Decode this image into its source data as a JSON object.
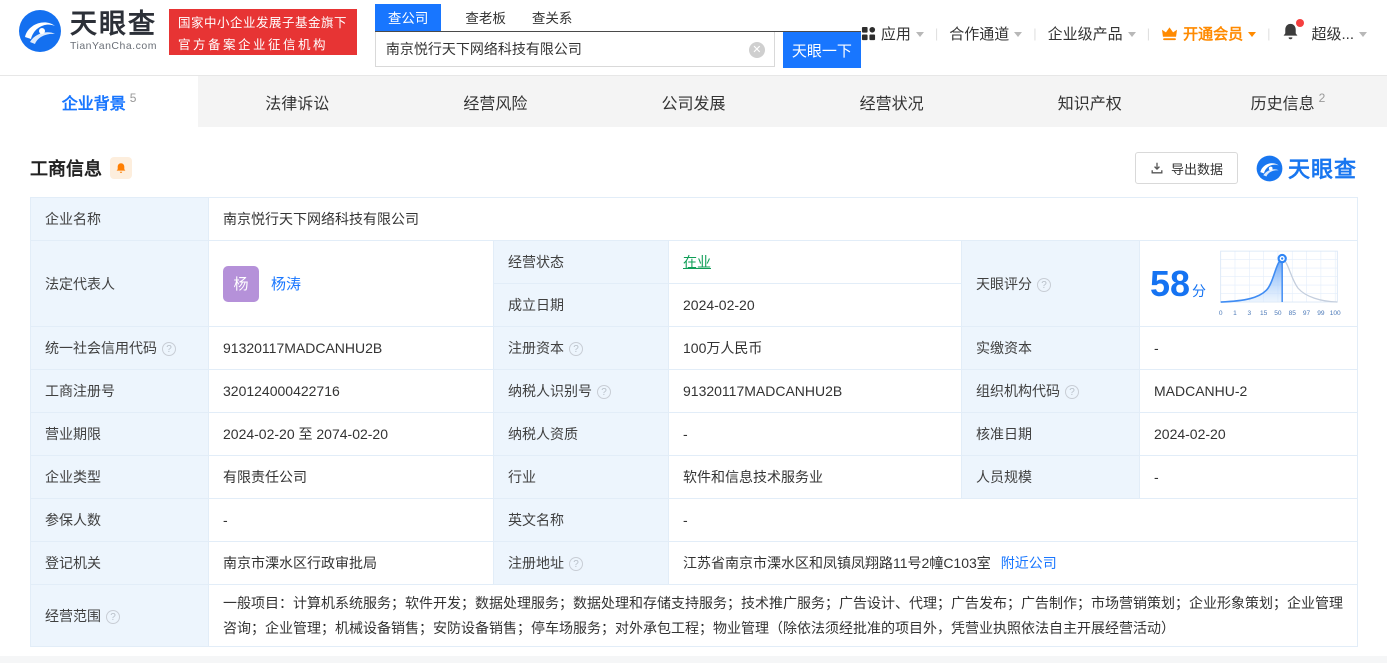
{
  "colors": {
    "accent_blue": "#1876ff",
    "badge_red": "#e73434",
    "vip_orange": "#ff8a00",
    "status_green": "#0f9e57",
    "avatar_purple": "#b591d9",
    "label_cell_bg": "#edf5fd"
  },
  "header": {
    "logo": {
      "title": "天眼查",
      "domain": "TianYanCha.com"
    },
    "badge": {
      "line1": "国家中小企业发展子基金旗下",
      "line2": "官方备案企业征信机构"
    },
    "search": {
      "tab_company": "查公司",
      "tab_boss": "查老板",
      "tab_relation": "查关系",
      "input_value": "南京悦行天下网络科技有限公司",
      "button_label": "天眼一下"
    },
    "nav": {
      "apps": "应用",
      "cooperation": "合作通道",
      "enterprise": "企业级产品",
      "vip": "开通会员",
      "super": "超级..."
    }
  },
  "tabs": {
    "background": {
      "label": "企业背景",
      "count": "5"
    },
    "legal": {
      "label": "法律诉讼"
    },
    "risk": {
      "label": "经营风险"
    },
    "development": {
      "label": "公司发展"
    },
    "operation": {
      "label": "经营状况"
    },
    "ip": {
      "label": "知识产权"
    },
    "history": {
      "label": "历史信息",
      "count": "2"
    }
  },
  "section": {
    "title": "工商信息",
    "export_label": "导出数据",
    "watermark": "天眼查"
  },
  "fields": {
    "name": {
      "label": "企业名称",
      "value": "南京悦行天下网络科技有限公司"
    },
    "legal": {
      "label": "法定代表人",
      "avatar": "杨",
      "value": "杨涛"
    },
    "status": {
      "label": "经营状态",
      "value": "在业"
    },
    "established": {
      "label": "成立日期",
      "value": "2024-02-20"
    },
    "credit_code": {
      "label": "统一社会信用代码",
      "value": "91320117MADCANHU2B"
    },
    "reg_capital": {
      "label": "注册资本",
      "value": "100万人民币"
    },
    "paid_capital": {
      "label": "实缴资本",
      "value": "-"
    },
    "reg_number": {
      "label": "工商注册号",
      "value": "320124000422716"
    },
    "taxpayer_id": {
      "label": "纳税人识别号",
      "value": "91320117MADCANHU2B"
    },
    "org_code": {
      "label": "组织机构代码",
      "value": "MADCANHU-2"
    },
    "biz_term": {
      "label": "营业期限",
      "value": "2024-02-20 至 2074-02-20"
    },
    "taxpayer_quality": {
      "label": "纳税人资质",
      "value": "-"
    },
    "approval_date": {
      "label": "核准日期",
      "value": "2024-02-20"
    },
    "company_type": {
      "label": "企业类型",
      "value": "有限责任公司"
    },
    "industry": {
      "label": "行业",
      "value": "软件和信息技术服务业"
    },
    "staff_size": {
      "label": "人员规模",
      "value": "-"
    },
    "insured_count": {
      "label": "参保人数",
      "value": "-"
    },
    "english_name": {
      "label": "英文名称",
      "value": "-"
    },
    "reg_authority": {
      "label": "登记机关",
      "value": "南京市溧水区行政审批局"
    },
    "reg_address": {
      "label": "注册地址",
      "value": "江苏省南京市溧水区和凤镇凤翔路11号2幢C103室",
      "link": "附近公司"
    },
    "biz_scope": {
      "label": "经营范围",
      "value": "一般项目：计算机系统服务；软件开发；数据处理服务；数据处理和存储支持服务；技术推广服务；广告设计、代理；广告发布；广告制作；市场营销策划；企业形象策划；企业管理咨询；企业管理；机械设备销售；安防设备销售；停车场服务；对外承包工程；物业管理（除依法须经批准的项目外，凭营业执照依法自主开展经营活动）"
    }
  },
  "score": {
    "label": "天眼评分",
    "value": "58",
    "unit": "分",
    "ticks": [
      "0",
      "1",
      "3",
      "15",
      "50",
      "85",
      "97",
      "99",
      "100"
    ]
  },
  "chart_data": {
    "type": "area",
    "title": "天眼评分分布曲线",
    "x_ticks": [
      0,
      1,
      3,
      15,
      50,
      85,
      97,
      99,
      100
    ],
    "marker_value": 58,
    "shape": "bell-curve, filled blue left of marker at 58, gray line to the right",
    "grid": true
  }
}
